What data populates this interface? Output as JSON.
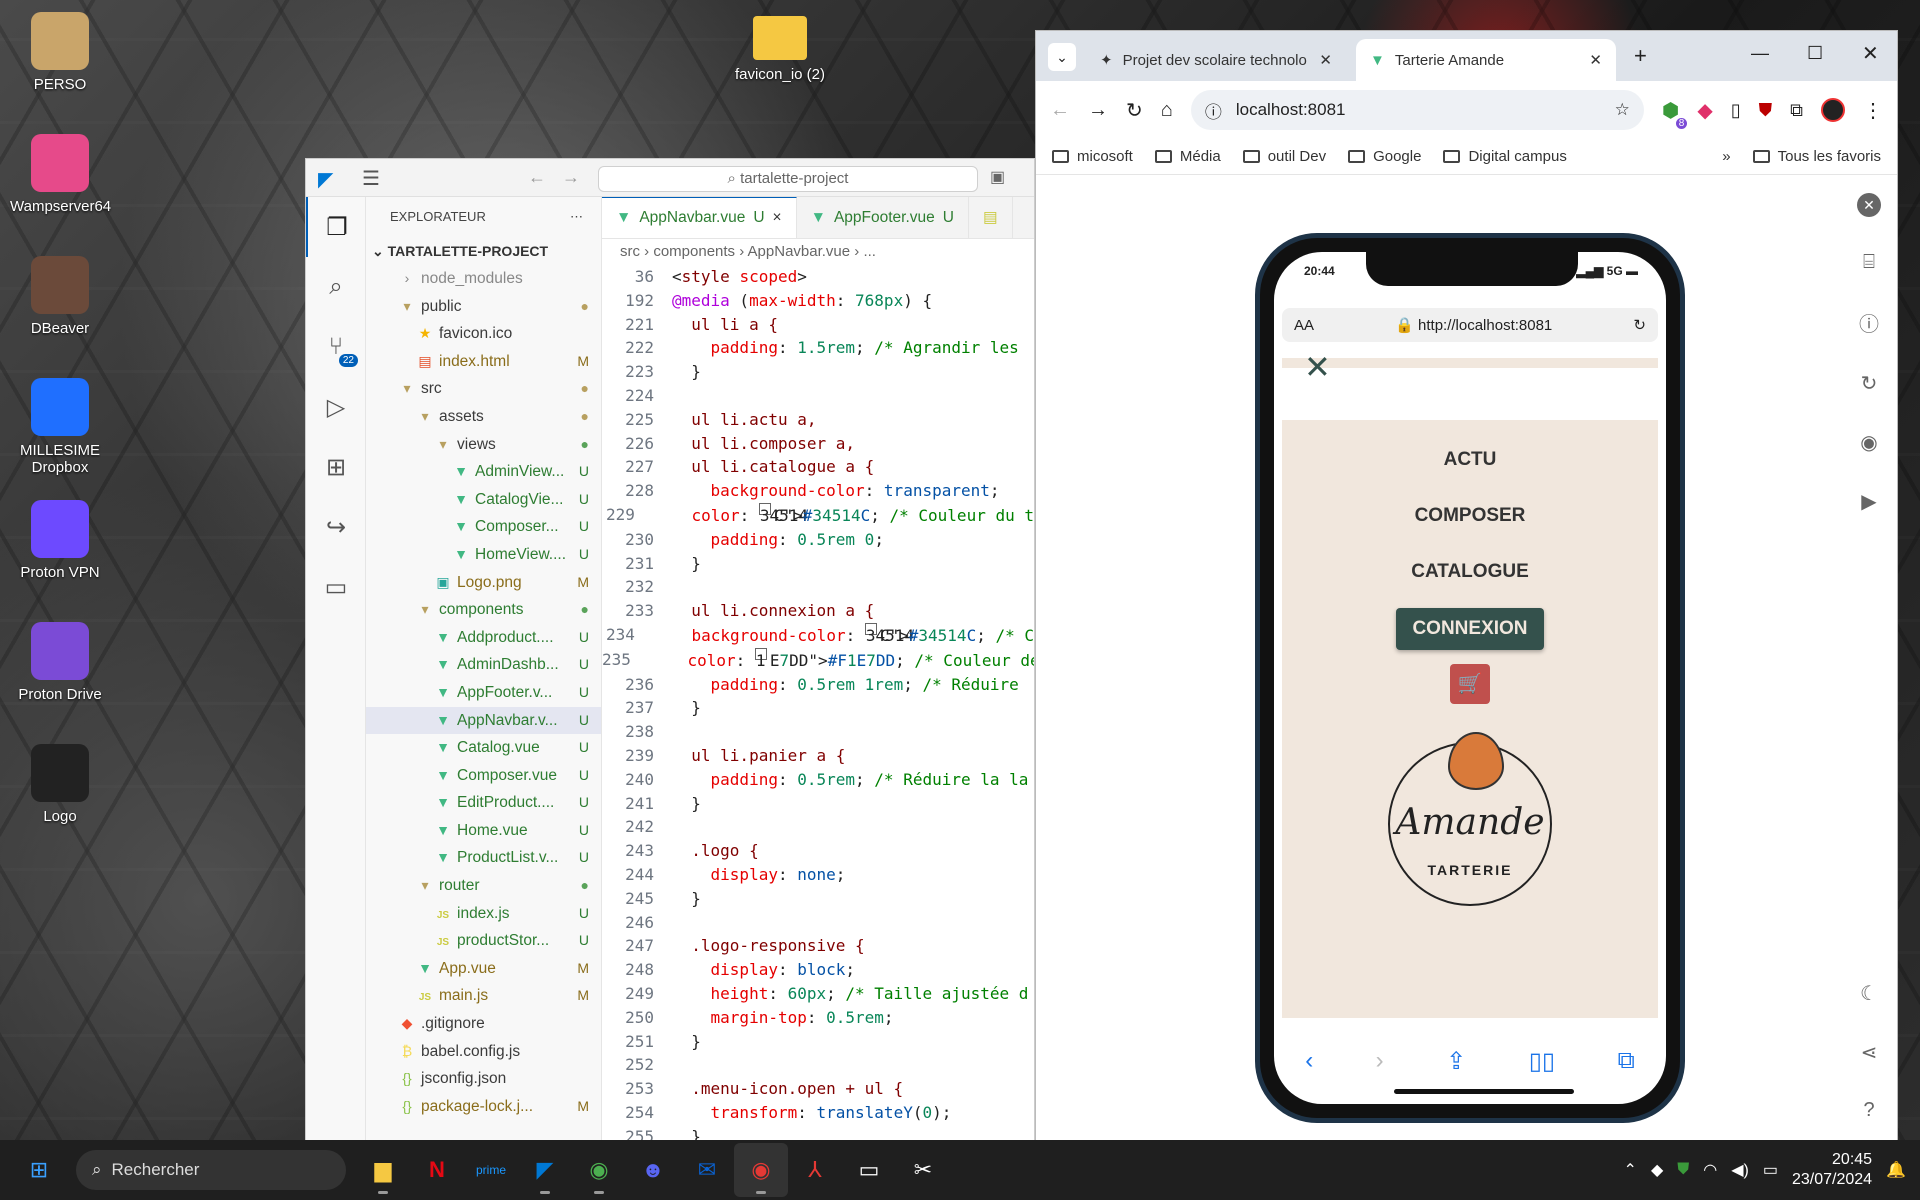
{
  "desktop": {
    "icons": [
      {
        "label": "PERSO",
        "color": "#c9a56a"
      },
      {
        "label": "Wampserver64",
        "color": "#e64a8a"
      },
      {
        "label": "DBeaver",
        "color": "#6b4a3a"
      },
      {
        "label": "MILLESIME Dropbox",
        "color": "#1f6fff"
      },
      {
        "label": "Proton VPN",
        "color": "#6d4aff"
      },
      {
        "label": "Proton Drive",
        "color": "#7b4bd6"
      },
      {
        "label": "Logo",
        "color": "#222"
      }
    ],
    "center_icon": "favicon_io (2)"
  },
  "vscode": {
    "search": "tartalette-project",
    "explorer_title": "EXPLORATEUR",
    "project": "TARTALETTE-PROJECT",
    "scm_badge": "22",
    "tree": [
      {
        "label": "node_modules",
        "indent": 1,
        "type": "folder-closed",
        "status": "",
        "color": "#888"
      },
      {
        "label": "public",
        "indent": 1,
        "type": "folder",
        "status": "●",
        "color": "#3b3b3b",
        "stcolor": "#b8a060"
      },
      {
        "label": "favicon.ico",
        "indent": 2,
        "type": "star",
        "status": "",
        "color": "#3b3b3b"
      },
      {
        "label": "index.html",
        "indent": 2,
        "type": "html",
        "status": "M",
        "color": "#8a6d1b",
        "stcolor": "#8a6d1b"
      },
      {
        "label": "src",
        "indent": 1,
        "type": "folder",
        "status": "●",
        "color": "#3b3b3b",
        "stcolor": "#b8a060"
      },
      {
        "label": "assets",
        "indent": 2,
        "type": "folder",
        "status": "●",
        "color": "#3b3b3b",
        "stcolor": "#b8a060"
      },
      {
        "label": "views",
        "indent": 3,
        "type": "folder",
        "status": "●",
        "color": "#3b3b3b",
        "stcolor": "#5aa35a"
      },
      {
        "label": "AdminView...",
        "indent": 4,
        "type": "vue",
        "status": "U",
        "color": "#2e7d32",
        "stcolor": "#2e7d32"
      },
      {
        "label": "CatalogVie...",
        "indent": 4,
        "type": "vue",
        "status": "U",
        "color": "#2e7d32",
        "stcolor": "#2e7d32"
      },
      {
        "label": "Composer...",
        "indent": 4,
        "type": "vue",
        "status": "U",
        "color": "#2e7d32",
        "stcolor": "#2e7d32"
      },
      {
        "label": "HomeView....",
        "indent": 4,
        "type": "vue",
        "status": "U",
        "color": "#2e7d32",
        "stcolor": "#2e7d32"
      },
      {
        "label": "Logo.png",
        "indent": 3,
        "type": "img",
        "status": "M",
        "color": "#8a6d1b",
        "stcolor": "#8a6d1b"
      },
      {
        "label": "components",
        "indent": 2,
        "type": "folder",
        "status": "●",
        "color": "#2e7d32",
        "stcolor": "#5aa35a"
      },
      {
        "label": "Addproduct....",
        "indent": 3,
        "type": "vue",
        "status": "U",
        "color": "#2e7d32",
        "stcolor": "#2e7d32"
      },
      {
        "label": "AdminDashb...",
        "indent": 3,
        "type": "vue",
        "status": "U",
        "color": "#2e7d32",
        "stcolor": "#2e7d32"
      },
      {
        "label": "AppFooter.v...",
        "indent": 3,
        "type": "vue",
        "status": "U",
        "color": "#2e7d32",
        "stcolor": "#2e7d32"
      },
      {
        "label": "AppNavbar.v...",
        "indent": 3,
        "type": "vue",
        "status": "U",
        "color": "#2e7d32",
        "stcolor": "#2e7d32",
        "sel": true
      },
      {
        "label": "Catalog.vue",
        "indent": 3,
        "type": "vue",
        "status": "U",
        "color": "#2e7d32",
        "stcolor": "#2e7d32"
      },
      {
        "label": "Composer.vue",
        "indent": 3,
        "type": "vue",
        "status": "U",
        "color": "#2e7d32",
        "stcolor": "#2e7d32"
      },
      {
        "label": "EditProduct....",
        "indent": 3,
        "type": "vue",
        "status": "U",
        "color": "#2e7d32",
        "stcolor": "#2e7d32"
      },
      {
        "label": "Home.vue",
        "indent": 3,
        "type": "vue",
        "status": "U",
        "color": "#2e7d32",
        "stcolor": "#2e7d32"
      },
      {
        "label": "ProductList.v...",
        "indent": 3,
        "type": "vue",
        "status": "U",
        "color": "#2e7d32",
        "stcolor": "#2e7d32"
      },
      {
        "label": "router",
        "indent": 2,
        "type": "folder",
        "status": "●",
        "color": "#2e7d32",
        "stcolor": "#5aa35a"
      },
      {
        "label": "index.js",
        "indent": 3,
        "type": "js",
        "status": "U",
        "color": "#2e7d32",
        "stcolor": "#2e7d32"
      },
      {
        "label": "productStor...",
        "indent": 3,
        "type": "js",
        "status": "U",
        "color": "#2e7d32",
        "stcolor": "#2e7d32"
      },
      {
        "label": "App.vue",
        "indent": 2,
        "type": "vue",
        "status": "M",
        "color": "#8a6d1b",
        "stcolor": "#8a6d1b"
      },
      {
        "label": "main.js",
        "indent": 2,
        "type": "js",
        "status": "M",
        "color": "#8a6d1b",
        "stcolor": "#8a6d1b"
      },
      {
        "label": ".gitignore",
        "indent": 1,
        "type": "git",
        "status": "",
        "color": "#3b3b3b"
      },
      {
        "label": "babel.config.js",
        "indent": 1,
        "type": "babel",
        "status": "",
        "color": "#3b3b3b"
      },
      {
        "label": "jsconfig.json",
        "indent": 1,
        "type": "json",
        "status": "",
        "color": "#3b3b3b"
      },
      {
        "label": "package-lock.j...",
        "indent": 1,
        "type": "json",
        "status": "M",
        "color": "#8a6d1b",
        "stcolor": "#8a6d1b"
      }
    ],
    "tabs": [
      {
        "label": "AppNavbar.vue",
        "status": "U",
        "close": "×"
      },
      {
        "label": "AppFooter.vue",
        "status": "U"
      }
    ],
    "breadcrumb": "src › components › AppNavbar.vue › ...",
    "code": [
      [
        "36",
        "<style scoped>"
      ],
      [
        "192",
        "@media (max-width: 768px) {"
      ],
      [
        "221",
        "  ul li a {"
      ],
      [
        "222",
        "    padding: 1.5rem; /* Agrandir les"
      ],
      [
        "223",
        "  }"
      ],
      [
        "224",
        ""
      ],
      [
        "225",
        "  ul li.actu a,"
      ],
      [
        "226",
        "  ul li.composer a,"
      ],
      [
        "227",
        "  ul li.catalogue a {"
      ],
      [
        "228",
        "    background-color: transparent;"
      ],
      [
        "229",
        "    color: #34514C; /* Couleur du t"
      ],
      [
        "230",
        "    padding: 0.5rem 0;"
      ],
      [
        "231",
        "  }"
      ],
      [
        "232",
        ""
      ],
      [
        "233",
        "  ul li.connexion a {"
      ],
      [
        "234",
        "    background-color: #34514C; /* C"
      ],
      [
        "235",
        "    color: #F1E7DD; /* Couleur de t"
      ],
      [
        "236",
        "    padding: 0.5rem 1rem; /* Réduire"
      ],
      [
        "237",
        "  }"
      ],
      [
        "238",
        ""
      ],
      [
        "239",
        "  ul li.panier a {"
      ],
      [
        "240",
        "    padding: 0.5rem; /* Réduire la la"
      ],
      [
        "241",
        "  }"
      ],
      [
        "242",
        ""
      ],
      [
        "243",
        "  .logo {"
      ],
      [
        "244",
        "    display: none;"
      ],
      [
        "245",
        "  }"
      ],
      [
        "246",
        ""
      ],
      [
        "247",
        "  .logo-responsive {"
      ],
      [
        "248",
        "    display: block;"
      ],
      [
        "249",
        "    height: 60px; /* Taille ajustée d"
      ],
      [
        "250",
        "    margin-top: 0.5rem;"
      ],
      [
        "251",
        "  }"
      ],
      [
        "252",
        ""
      ],
      [
        "253",
        "  .menu-icon.open + ul {"
      ],
      [
        "254",
        "    transform: translateY(0);"
      ],
      [
        "255",
        "  }"
      ]
    ]
  },
  "chrome": {
    "tabs": [
      {
        "label": "Projet dev scolaire technolo"
      },
      {
        "label": "Tarterie Amande"
      }
    ],
    "url": "localhost:8081",
    "ext_badge": "8",
    "bookmarks": [
      "micosoft",
      "Média",
      "outil Dev",
      "Google",
      "Digital campus"
    ],
    "all_bookmarks": "Tous les favoris"
  },
  "phone": {
    "time": "20:44",
    "signal": "5G",
    "aa": "AA",
    "url": "http://localhost:8081",
    "menu": [
      "ACTU",
      "COMPOSER",
      "CATALOGUE"
    ],
    "connexion": "CONNEXION",
    "logo_text": "Amande",
    "logo_sub": "TARTERIE",
    "brand_dark": "#34514c",
    "brand_light": "#f1e7dd"
  },
  "taskbar": {
    "search": "Rechercher",
    "time": "20:45",
    "date": "23/07/2024"
  }
}
